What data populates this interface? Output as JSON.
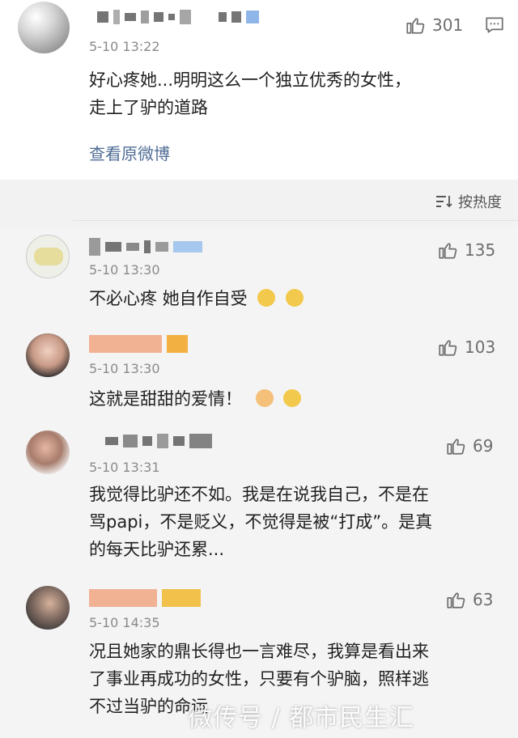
{
  "post": {
    "time": "5-10 13:22",
    "text_line1": "好心疼她...明明这么一个独立优秀的女性，",
    "text_line2": "走上了驴的道路",
    "likes": "301",
    "view_original": "查看原微博"
  },
  "sort": {
    "label": "按热度"
  },
  "comments": [
    {
      "time": "5-10 13:30",
      "likes": "135",
      "text": "不必心疼 她自作自受"
    },
    {
      "time": "5-10 13:30",
      "likes": "103",
      "text": "这就是甜甜的爱情！"
    },
    {
      "time": "5-10 13:31",
      "likes": "69",
      "line1": "我觉得比驴还不如。我是在说我自己，不是在",
      "line2": "骂papi，不是贬义，不觉得是被“打成”。是真",
      "line3": "的每天比驴还累..."
    },
    {
      "time": "5-10 14:35",
      "likes": "63",
      "line1": "况且她家的鼎长得也一言难尽，我算是看出来",
      "line2": "了事业再成功的女性，只要有个驴脑，照样逃",
      "line3": "不过当驴的命运"
    }
  ],
  "watermark": "微传号 / 都市民生汇",
  "colors": {
    "link": "#506d96",
    "bg": "#f2f2f2",
    "card": "#ffffff"
  },
  "icons": [
    "thumb-up-icon",
    "comment-icon",
    "sort-icon"
  ]
}
